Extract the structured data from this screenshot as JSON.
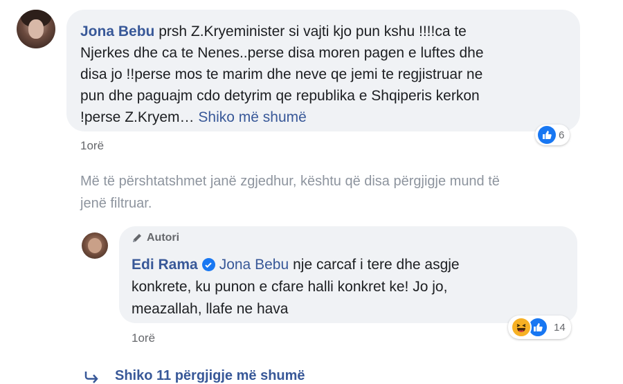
{
  "comment": {
    "author": "Jona Bebu",
    "lines": [
      "prsh Z.Kryeminister si vajti kjo pun kshu !!!!ca te",
      "Njerkes dhe ca te Nenes..perse disa moren pagen e luftes dhe",
      "disa jo !!perse mos te marim dhe neve qe jemi te regjistruar ne",
      "pun dhe paguajm cdo detyrim qe republika e Shqiperis kerkon",
      "!perse Z.Kryem…"
    ],
    "see_more": "Shiko më shumë",
    "reaction_count": "6",
    "time": "1orë"
  },
  "filter_notice": {
    "line1": "Më të përshtatshmet janë zgjedhur, kështu që disa përgjigje mund të",
    "line2": "jenë filtruar."
  },
  "reply": {
    "badge": "Autori",
    "author": "Edi Rama",
    "mention": "Jona Bebu",
    "line1_rest": "nje carcaf i tere dhe asgje",
    "line2": "konkrete, ku punon e cfare halli konkret ke! Jo jo,",
    "line3": "meazallah, llafe ne hava",
    "reaction_count": "14",
    "time": "1orë"
  },
  "more_replies": "Shiko 11 përgjigje më shumë",
  "colors": {
    "link": "#385898",
    "like_blue": "#1877f2",
    "bubble": "#f0f2f5",
    "haha_yellow": "#f7b125"
  }
}
